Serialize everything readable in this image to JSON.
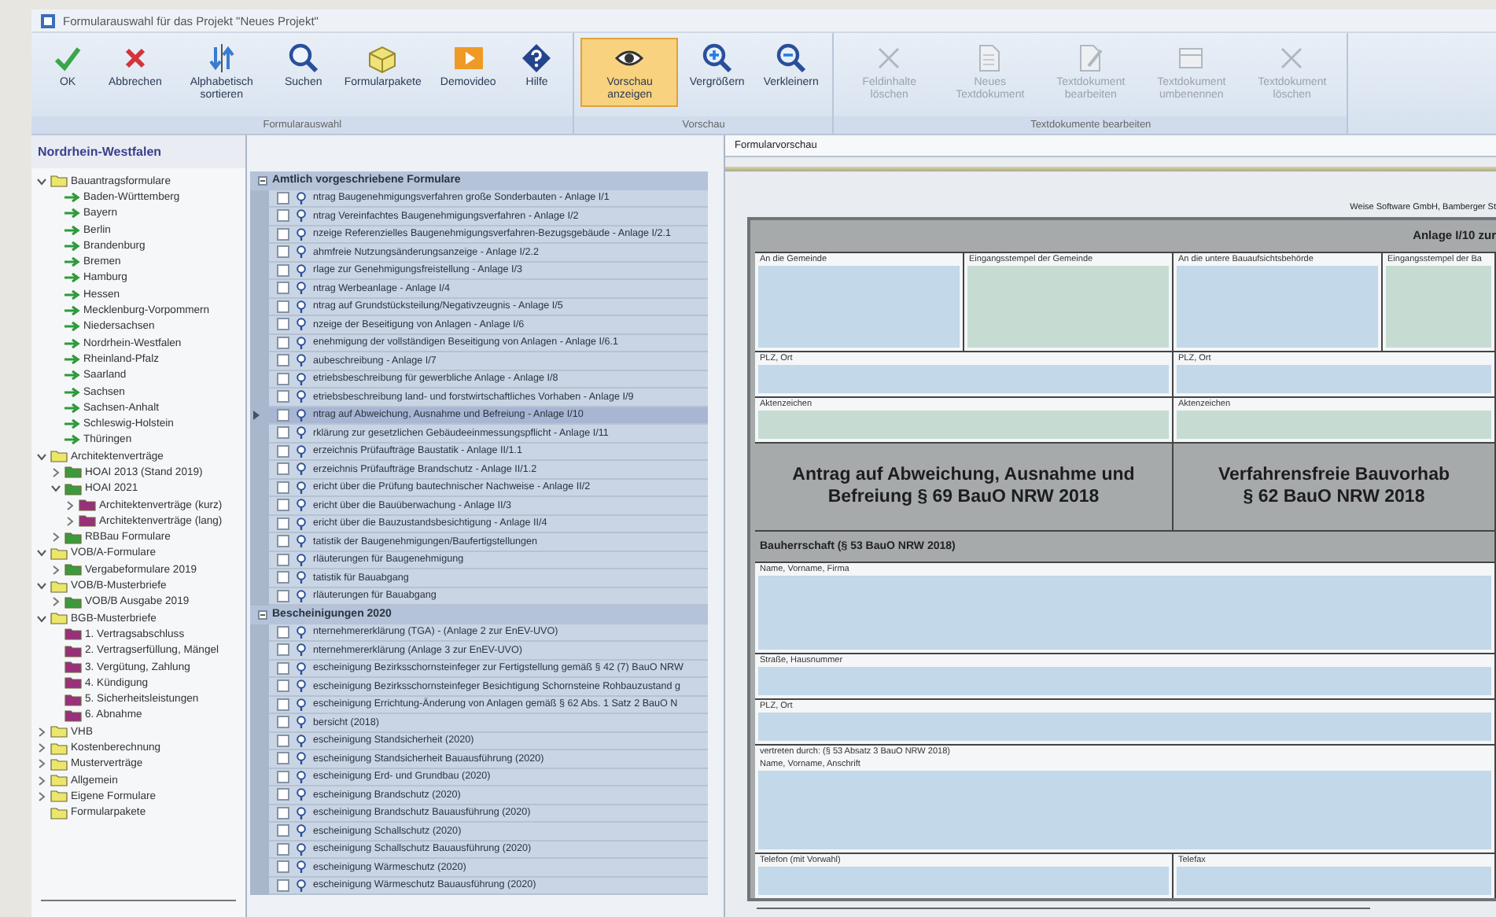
{
  "window": {
    "title": "Formularauswahl für das Projekt \"Neues Projekt\""
  },
  "toolbar": {
    "groups": [
      {
        "label": "Formularauswahl",
        "buttons": [
          {
            "label": "OK",
            "selected": false,
            "disabled": false
          },
          {
            "label": "Abbrechen",
            "selected": false,
            "disabled": false
          },
          {
            "label": "Alphabetisch sortieren",
            "selected": false,
            "disabled": false
          },
          {
            "label": "Suchen",
            "selected": false,
            "disabled": false
          },
          {
            "label": "Formularpakete",
            "selected": false,
            "disabled": false
          },
          {
            "label": "Demovideo",
            "selected": false,
            "disabled": false
          },
          {
            "label": "Hilfe",
            "selected": false,
            "disabled": false
          }
        ]
      },
      {
        "label": "Vorschau",
        "buttons": [
          {
            "label": "Vorschau anzeigen",
            "selected": true,
            "disabled": false
          },
          {
            "label": "Vergrößern",
            "selected": false,
            "disabled": false
          },
          {
            "label": "Verkleinern",
            "selected": false,
            "disabled": false
          }
        ]
      },
      {
        "label": "Textdokumente bearbeiten",
        "buttons": [
          {
            "label": "Feldinhalte löschen",
            "selected": false,
            "disabled": true
          },
          {
            "label": "Neues Textdokument",
            "selected": false,
            "disabled": true
          },
          {
            "label": "Textdokument bearbeiten",
            "selected": false,
            "disabled": true
          },
          {
            "label": "Textdokument umbenennen",
            "selected": false,
            "disabled": true
          },
          {
            "label": "Textdokument löschen",
            "selected": false,
            "disabled": true
          }
        ]
      }
    ]
  },
  "tree": {
    "heading": "Nordrhein-Westfalen",
    "items": [
      {
        "label": "Bauantragsformulare",
        "kind": "folder",
        "color": "#ece66a",
        "expanded": true,
        "children": [
          {
            "label": "Baden-Württemberg",
            "kind": "link"
          },
          {
            "label": "Bayern",
            "kind": "link"
          },
          {
            "label": "Berlin",
            "kind": "link"
          },
          {
            "label": "Brandenburg",
            "kind": "link"
          },
          {
            "label": "Bremen",
            "kind": "link"
          },
          {
            "label": "Hamburg",
            "kind": "link"
          },
          {
            "label": "Hessen",
            "kind": "link"
          },
          {
            "label": "Mecklenburg-Vorpommern",
            "kind": "link"
          },
          {
            "label": "Niedersachsen",
            "kind": "link"
          },
          {
            "label": "Nordrhein-Westfalen",
            "kind": "link"
          },
          {
            "label": "Rheinland-Pfalz",
            "kind": "link"
          },
          {
            "label": "Saarland",
            "kind": "link"
          },
          {
            "label": "Sachsen",
            "kind": "link"
          },
          {
            "label": "Sachsen-Anhalt",
            "kind": "link"
          },
          {
            "label": "Schleswig-Holstein",
            "kind": "link"
          },
          {
            "label": "Thüringen",
            "kind": "link"
          }
        ]
      },
      {
        "label": "Architektenverträge",
        "kind": "folder",
        "color": "#ece66a",
        "expanded": true,
        "children": [
          {
            "label": "HOAI 2013 (Stand 2019)",
            "kind": "folder",
            "color": "#3c9a3c",
            "expanded": false
          },
          {
            "label": "HOAI 2021",
            "kind": "folder",
            "color": "#3c9a3c",
            "expanded": true,
            "children": [
              {
                "label": "Architektenverträge (kurz)",
                "kind": "folder",
                "color": "#9a2f7c",
                "expanded": false
              },
              {
                "label": "Architektenverträge (lang)",
                "kind": "folder",
                "color": "#9a2f7c",
                "expanded": false
              }
            ]
          },
          {
            "label": "RBBau Formulare",
            "kind": "folder",
            "color": "#3c9a3c",
            "expanded": false
          }
        ]
      },
      {
        "label": "VOB/A-Formulare",
        "kind": "folder",
        "color": "#ece66a",
        "expanded": true,
        "children": [
          {
            "label": "Vergabeformulare 2019",
            "kind": "folder",
            "color": "#3c9a3c",
            "expanded": false
          }
        ]
      },
      {
        "label": "VOB/B-Musterbriefe",
        "kind": "folder",
        "color": "#ece66a",
        "expanded": true,
        "children": [
          {
            "label": "VOB/B Ausgabe 2019",
            "kind": "folder",
            "color": "#3c9a3c",
            "expanded": false
          }
        ]
      },
      {
        "label": "BGB-Musterbriefe",
        "kind": "folder",
        "color": "#ece66a",
        "expanded": true,
        "children": [
          {
            "label": "1. Vertragsabschluss",
            "kind": "folder",
            "color": "#9a2f7c"
          },
          {
            "label": "2. Vertragserfüllung, Mängel",
            "kind": "folder",
            "color": "#9a2f7c"
          },
          {
            "label": "3. Vergütung, Zahlung",
            "kind": "folder",
            "color": "#9a2f7c"
          },
          {
            "label": "4. Kündigung",
            "kind": "folder",
            "color": "#9a2f7c"
          },
          {
            "label": "5. Sicherheitsleistungen",
            "kind": "folder",
            "color": "#9a2f7c"
          },
          {
            "label": "6. Abnahme",
            "kind": "folder",
            "color": "#9a2f7c"
          }
        ]
      },
      {
        "label": "VHB",
        "kind": "folder",
        "color": "#ece66a",
        "expanded": false
      },
      {
        "label": "Kostenberechnung",
        "kind": "folder",
        "color": "#ece66a",
        "expanded": false
      },
      {
        "label": "Musterverträge",
        "kind": "folder",
        "color": "#ece66a",
        "expanded": false
      },
      {
        "label": "Allgemein",
        "kind": "folder",
        "color": "#ece66a",
        "expanded": false
      },
      {
        "label": "Eigene Formulare",
        "kind": "folder",
        "color": "#ece66a",
        "expanded": false
      },
      {
        "label": "Formularpakete",
        "kind": "folder",
        "color": "#ece66a"
      }
    ]
  },
  "form_list": {
    "groups": [
      {
        "title": "Amtlich vorgeschriebene Formulare",
        "expanded": true,
        "items": [
          {
            "label": "ntrag Baugenehmigungsverfahren große Sonderbauten - Anlage I/1",
            "checked": false,
            "selected": false
          },
          {
            "label": "ntrag Vereinfachtes Baugenehmigungsverfahren - Anlage I/2",
            "checked": false,
            "selected": false
          },
          {
            "label": "nzeige Referenzielles Baugenehmigungsverfahren-Bezugsgebäude - Anlage I/2.1",
            "checked": false,
            "selected": false
          },
          {
            "label": "ahmfreie Nutzungsänderungsanzeige - Anlage I/2.2",
            "checked": false,
            "selected": false
          },
          {
            "label": "rlage zur Genehmigungsfreistellung - Anlage I/3",
            "checked": false,
            "selected": false
          },
          {
            "label": "ntrag Werbeanlage - Anlage I/4",
            "checked": false,
            "selected": false
          },
          {
            "label": "ntrag auf Grundstücksteilung/Negativzeugnis - Anlage I/5",
            "checked": false,
            "selected": false
          },
          {
            "label": "nzeige der Beseitigung von Anlagen - Anlage I/6",
            "checked": false,
            "selected": false
          },
          {
            "label": "enehmigung der vollständigen Beseitigung von Anlagen - Anlage I/6.1",
            "checked": false,
            "selected": false
          },
          {
            "label": "aubeschreibung - Anlage I/7",
            "checked": false,
            "selected": false
          },
          {
            "label": "etriebsbeschreibung für gewerbliche Anlage - Anlage I/8",
            "checked": false,
            "selected": false
          },
          {
            "label": "etriebsbeschreibung land- und forstwirtschaftliches Vorhaben - Anlage I/9",
            "checked": false,
            "selected": false
          },
          {
            "label": "ntrag auf Abweichung, Ausnahme und Befreiung - Anlage I/10",
            "checked": false,
            "selected": true
          },
          {
            "label": "rklärung zur gesetzlichen Gebäudeeinmessungspflicht - Anlage I/11",
            "checked": false,
            "selected": false
          },
          {
            "label": "erzeichnis Prüfaufträge Baustatik - Anlage II/1.1",
            "checked": false,
            "selected": false
          },
          {
            "label": "erzeichnis Prüfaufträge Brandschutz - Anlage II/1.2",
            "checked": false,
            "selected": false
          },
          {
            "label": "ericht über die Prüfung bautechnischer Nachweise - Anlage II/2",
            "checked": false,
            "selected": false
          },
          {
            "label": "ericht über die Bauüberwachung - Anlage II/3",
            "checked": false,
            "selected": false
          },
          {
            "label": "ericht über die Bauzustandsbesichtigung - Anlage II/4",
            "checked": false,
            "selected": false
          },
          {
            "label": "tatistik der Baugenehmigungen/Baufertigstellungen",
            "checked": false,
            "selected": false
          },
          {
            "label": "rläuterungen für Baugenehmigung",
            "checked": false,
            "selected": false
          },
          {
            "label": "tatistik für Bauabgang",
            "checked": false,
            "selected": false
          },
          {
            "label": "rläuterungen für Bauabgang",
            "checked": false,
            "selected": false
          }
        ]
      },
      {
        "title": "Bescheinigungen 2020",
        "expanded": true,
        "items": [
          {
            "label": "nternehmererklärung (TGA) - (Anlage 2 zur EnEV-UVO)",
            "checked": false,
            "selected": false
          },
          {
            "label": "nternehmererklärung (Anlage 3 zur EnEV-UVO)",
            "checked": false,
            "selected": false
          },
          {
            "label": "escheinigung Bezirksschornsteinfeger zur Fertigstellung gemäß § 42 (7) BauO NRW",
            "checked": false,
            "selected": false
          },
          {
            "label": "escheinigung Bezirksschornsteinfeger Besichtigung Schornsteine Rohbauzustand g",
            "checked": false,
            "selected": false
          },
          {
            "label": "escheinigung Errichtung-Änderung von Anlagen gemäß § 62 Abs. 1 Satz 2 BauO N",
            "checked": false,
            "selected": false
          },
          {
            "label": "bersicht (2018)",
            "checked": false,
            "selected": false
          },
          {
            "label": "escheinigung Standsicherheit (2020)",
            "checked": false,
            "selected": false
          },
          {
            "label": "escheinigung Standsicherheit Bauausführung (2020)",
            "checked": false,
            "selected": false
          },
          {
            "label": "escheinigung Erd- und Grundbau (2020)",
            "checked": false,
            "selected": false
          },
          {
            "label": "escheinigung Brandschutz (2020)",
            "checked": false,
            "selected": false
          },
          {
            "label": "escheinigung Brandschutz Bauausführung (2020)",
            "checked": false,
            "selected": false
          },
          {
            "label": "escheinigung Schallschutz (2020)",
            "checked": false,
            "selected": false
          },
          {
            "label": "escheinigung Schallschutz Bauausführung (2020)",
            "checked": false,
            "selected": false
          },
          {
            "label": "escheinigung Wärmeschutz (2020)",
            "checked": false,
            "selected": false
          },
          {
            "label": "escheinigung Wärmeschutz Bauausführung (2020)",
            "checked": false,
            "selected": false
          }
        ]
      }
    ]
  },
  "preview": {
    "tab": "Formularvorschau",
    "publisher": "Weise Software GmbH, Bamberger St",
    "annex": "Anlage I/10 zur",
    "rows": [
      {
        "kind": "stamp",
        "cells": [
          {
            "labels": [
              "An die Gemeinde"
            ],
            "color": "#c3d8e8"
          },
          {
            "labels": [
              "Eingangsstempel der Gemeinde"
            ],
            "color": "#c6dcd3"
          },
          {
            "labels": [
              "An die untere Bauaufsichtsbehörde"
            ],
            "color": "#c3d8e8"
          },
          {
            "labels": [
              "Eingangsstempel der Ba"
            ],
            "color": "#c6dcd3"
          }
        ]
      },
      {
        "kind": "line",
        "cells": [
          {
            "labels": [
              "PLZ, Ort"
            ],
            "color": "#c3d8e8"
          },
          {
            "labels": [
              "PLZ, Ort"
            ],
            "color": "#c3d8e8"
          }
        ]
      },
      {
        "kind": "line",
        "cells": [
          {
            "labels": [
              "Aktenzeichen"
            ],
            "color": "#c6dcd3"
          },
          {
            "labels": [
              "Aktenzeichen"
            ],
            "color": "#c6dcd3"
          }
        ]
      },
      {
        "kind": "title",
        "cells": [
          {
            "labels": [
              "Antrag auf Abweichung, Ausnahme und",
              "Befreiung § 69 BauO NRW 2018"
            ]
          },
          {
            "labels": [
              "Verfahrensfreie Bauvorhab",
              "§ 62 BauO NRW 2018"
            ]
          }
        ]
      },
      {
        "kind": "section",
        "cells": [
          {
            "labels": [
              "Bauherrschaft (§ 53 BauO NRW 2018)"
            ]
          }
        ]
      },
      {
        "kind": "area",
        "cells": [
          {
            "labels": [
              "Name, Vorname, Firma"
            ],
            "color": "#c3d8e8"
          }
        ]
      },
      {
        "kind": "line",
        "cells": [
          {
            "labels": [
              "Straße, Hausnummer"
            ],
            "color": "#c3d8e8"
          }
        ]
      },
      {
        "kind": "line",
        "cells": [
          {
            "labels": [
              "PLZ, Ort"
            ],
            "color": "#c3d8e8"
          }
        ]
      },
      {
        "kind": "tall",
        "cells": [
          {
            "labels": [
              "vertreten durch: (§ 53 Absatz 3 BauO NRW 2018)",
              "Name, Vorname, Anschrift"
            ],
            "color": "#c3d8e8"
          }
        ]
      },
      {
        "kind": "line",
        "cells": [
          {
            "labels": [
              "Telefon (mit Vorwahl)"
            ],
            "color": "#c3d8e8"
          },
          {
            "labels": [
              "Telefax"
            ],
            "color": "#c3d8e8"
          }
        ]
      }
    ]
  }
}
